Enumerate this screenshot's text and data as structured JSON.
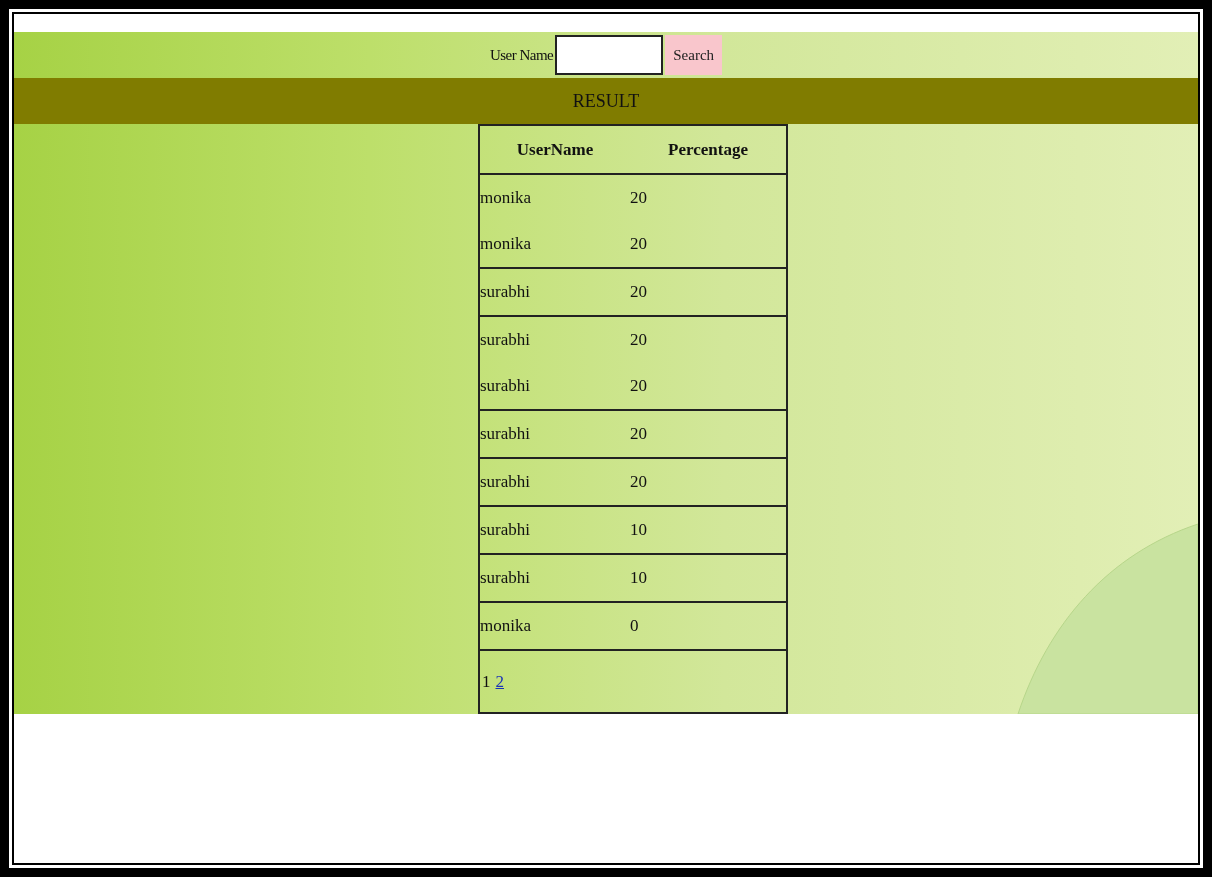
{
  "search": {
    "label": "User Name",
    "button": "Search"
  },
  "result_bar": {
    "title": "RESULT"
  },
  "table": {
    "columns": [
      "UserName",
      "Percentage"
    ],
    "groups": [
      {
        "rows": [
          {
            "user": "monika",
            "percentage": "20"
          },
          {
            "user": "monika",
            "percentage": "20"
          }
        ]
      },
      {
        "rows": [
          {
            "user": "surabhi",
            "percentage": "20"
          }
        ]
      },
      {
        "rows": [
          {
            "user": "surabhi",
            "percentage": "20"
          },
          {
            "user": "surabhi",
            "percentage": "20"
          }
        ]
      },
      {
        "rows": [
          {
            "user": "surabhi",
            "percentage": "20"
          }
        ]
      },
      {
        "rows": [
          {
            "user": "surabhi",
            "percentage": "20"
          }
        ]
      },
      {
        "rows": [
          {
            "user": "surabhi",
            "percentage": "10"
          }
        ]
      },
      {
        "rows": [
          {
            "user": "surabhi",
            "percentage": "10"
          }
        ]
      },
      {
        "rows": [
          {
            "user": "monika",
            "percentage": "0"
          }
        ]
      }
    ],
    "pages": [
      {
        "label": "1",
        "selected": true
      },
      {
        "label": "2",
        "selected": false
      }
    ]
  }
}
